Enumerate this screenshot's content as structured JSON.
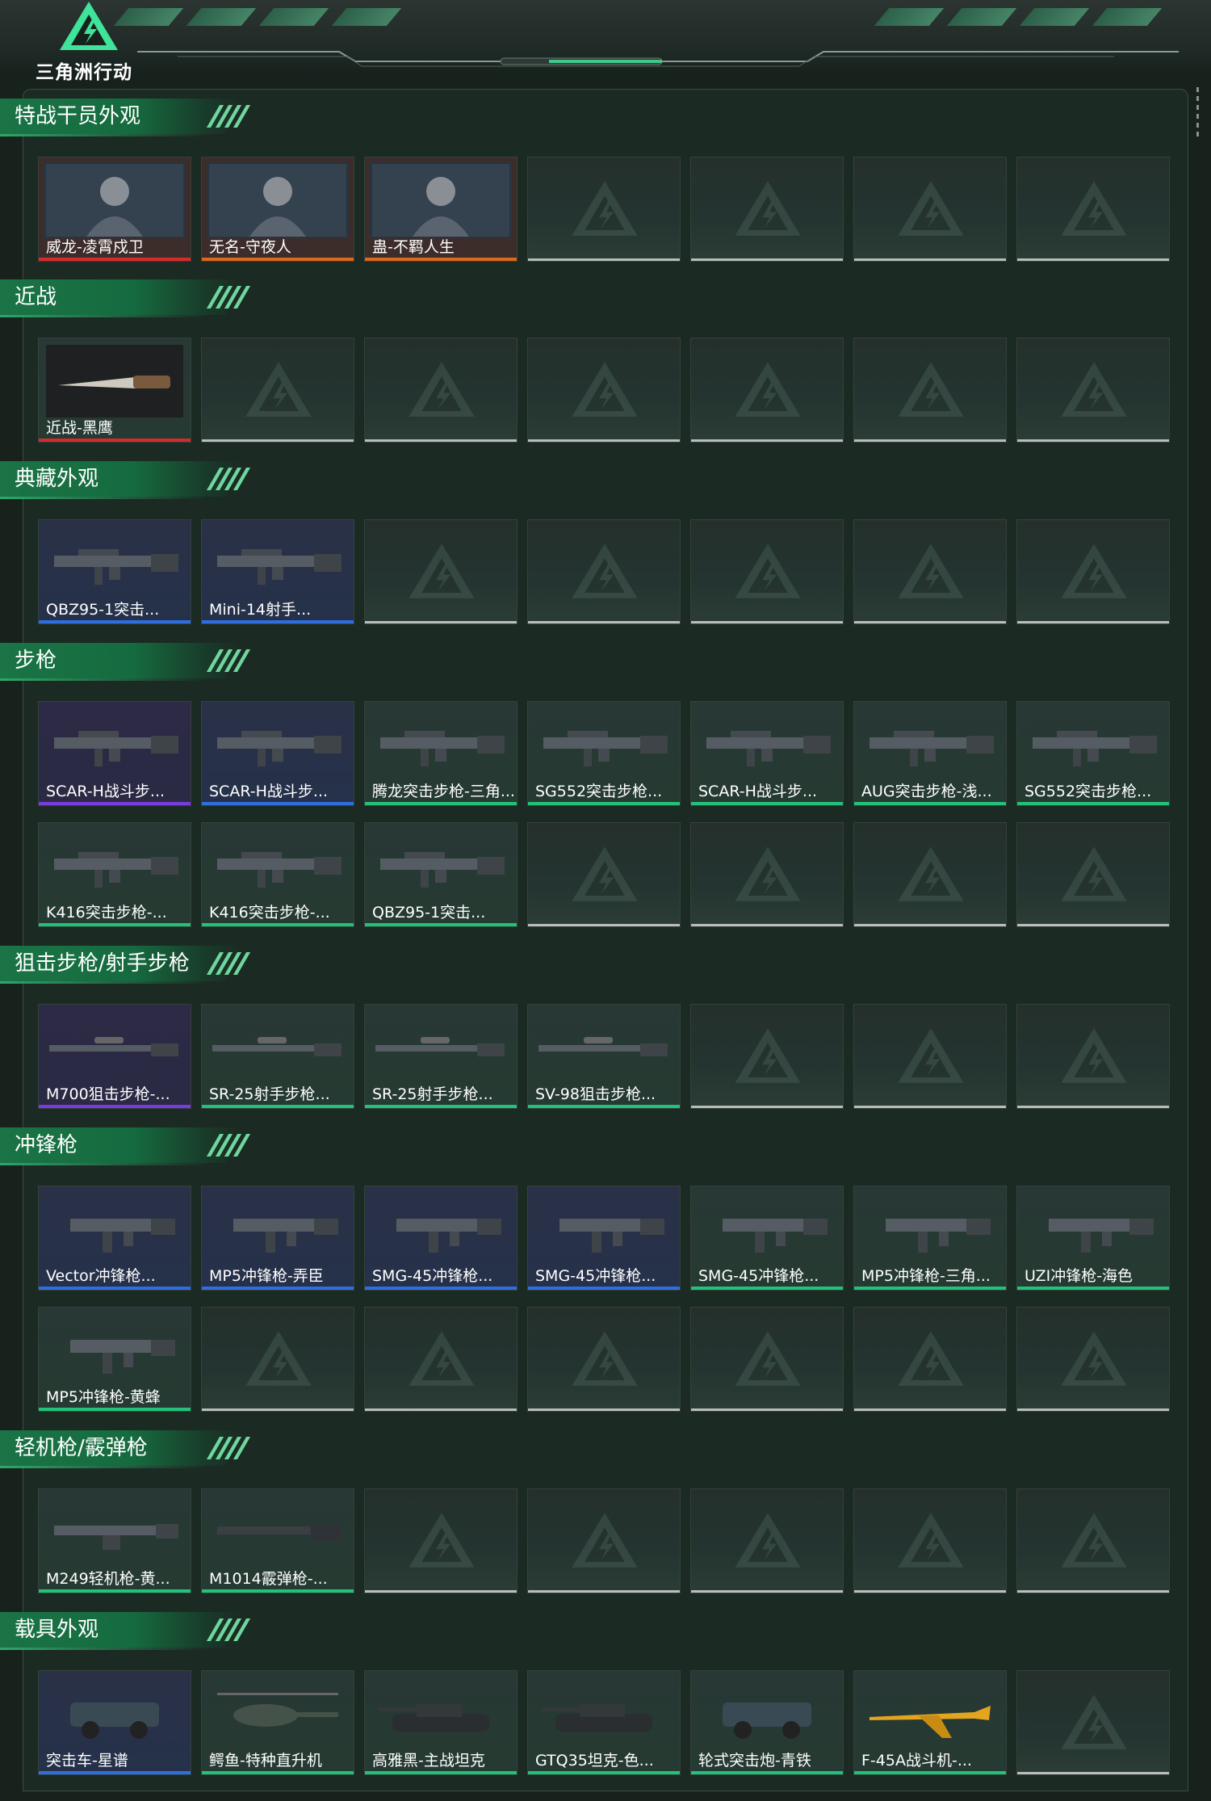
{
  "header": {
    "logo_text": "三角洲行动"
  },
  "colors": {
    "accent_green": "#1a7a48",
    "rarity_red": "#d82a2a",
    "rarity_orange": "#e0661c",
    "rarity_purple": "#7a3be0",
    "rarity_blue": "#2f6ee0",
    "rarity_green": "#22c27a",
    "empty_bar": "#b9bdbb"
  },
  "sections": [
    {
      "title": "特战干员外观",
      "items": [
        {
          "label": "威龙-凌霄戍卫",
          "rarity": "red",
          "icon": "operator-portrait-icon"
        },
        {
          "label": "无名-守夜人",
          "rarity": "orange",
          "icon": "operator-portrait-icon"
        },
        {
          "label": "蛊-不羁人生",
          "rarity": "orange",
          "icon": "operator-portrait-icon"
        }
      ]
    },
    {
      "title": "近战",
      "items": [
        {
          "label": "近战-黑鹰",
          "rarity": "red",
          "icon": "knife-icon"
        }
      ]
    },
    {
      "title": "典藏外观",
      "items": [
        {
          "label": "QBZ95-1突击...",
          "rarity": "blue",
          "icon": "rifle-icon"
        },
        {
          "label": "Mini-14射手...",
          "rarity": "blue",
          "icon": "rifle-icon"
        }
      ]
    },
    {
      "title": "步枪",
      "items": [
        {
          "label": "SCAR-H战斗步...",
          "rarity": "purple",
          "icon": "rifle-icon"
        },
        {
          "label": "SCAR-H战斗步...",
          "rarity": "blue",
          "icon": "rifle-icon"
        },
        {
          "label": "腾龙突击步枪-三角...",
          "rarity": "green",
          "icon": "rifle-icon"
        },
        {
          "label": "SG552突击步枪...",
          "rarity": "green",
          "icon": "rifle-icon"
        },
        {
          "label": "SCAR-H战斗步...",
          "rarity": "green",
          "icon": "rifle-icon"
        },
        {
          "label": "AUG突击步枪-浅...",
          "rarity": "green",
          "icon": "rifle-icon"
        },
        {
          "label": "SG552突击步枪...",
          "rarity": "green",
          "icon": "rifle-icon"
        },
        {
          "label": "K416突击步枪-...",
          "rarity": "green",
          "icon": "rifle-icon"
        },
        {
          "label": "K416突击步枪-...",
          "rarity": "green",
          "icon": "rifle-icon"
        },
        {
          "label": "QBZ95-1突击...",
          "rarity": "green",
          "icon": "rifle-icon"
        }
      ]
    },
    {
      "title": "狙击步枪/射手步枪",
      "items": [
        {
          "label": "M700狙击步枪-...",
          "rarity": "purple",
          "icon": "sniper-icon"
        },
        {
          "label": "SR-25射手步枪...",
          "rarity": "green",
          "icon": "sniper-icon"
        },
        {
          "label": "SR-25射手步枪...",
          "rarity": "green",
          "icon": "sniper-icon"
        },
        {
          "label": "SV-98狙击步枪...",
          "rarity": "green",
          "icon": "sniper-icon"
        }
      ]
    },
    {
      "title": "冲锋枪",
      "items": [
        {
          "label": "Vector冲锋枪...",
          "rarity": "blue",
          "icon": "smg-icon"
        },
        {
          "label": "MP5冲锋枪-弄臣",
          "rarity": "blue",
          "icon": "smg-icon"
        },
        {
          "label": "SMG-45冲锋枪...",
          "rarity": "blue",
          "icon": "smg-icon"
        },
        {
          "label": "SMG-45冲锋枪...",
          "rarity": "blue",
          "icon": "smg-icon"
        },
        {
          "label": "SMG-45冲锋枪...",
          "rarity": "green",
          "icon": "smg-icon"
        },
        {
          "label": "MP5冲锋枪-三角...",
          "rarity": "green",
          "icon": "smg-icon"
        },
        {
          "label": "UZI冲锋枪-海色",
          "rarity": "green",
          "icon": "smg-icon"
        },
        {
          "label": "MP5冲锋枪-黄蜂",
          "rarity": "green",
          "icon": "smg-icon"
        }
      ]
    },
    {
      "title": "轻机枪/霰弹枪",
      "items": [
        {
          "label": "M249轻机枪-黄...",
          "rarity": "green",
          "icon": "lmg-icon"
        },
        {
          "label": "M1014霰弹枪-...",
          "rarity": "green",
          "icon": "shotgun-icon"
        }
      ]
    },
    {
      "title": "载具外观",
      "items": [
        {
          "label": "突击车-星谱",
          "rarity": "blue",
          "icon": "vehicle-icon"
        },
        {
          "label": "鳄鱼-特种直升机",
          "rarity": "green",
          "icon": "helicopter-icon"
        },
        {
          "label": "高雅黑-主战坦克",
          "rarity": "green",
          "icon": "tank-icon"
        },
        {
          "label": "GTQ35坦克-色...",
          "rarity": "green",
          "icon": "tank-icon"
        },
        {
          "label": "轮式突击炮-青铁",
          "rarity": "green",
          "icon": "vehicle-icon"
        },
        {
          "label": "F-45A战斗机-...",
          "rarity": "green",
          "icon": "jet-icon"
        }
      ]
    }
  ]
}
